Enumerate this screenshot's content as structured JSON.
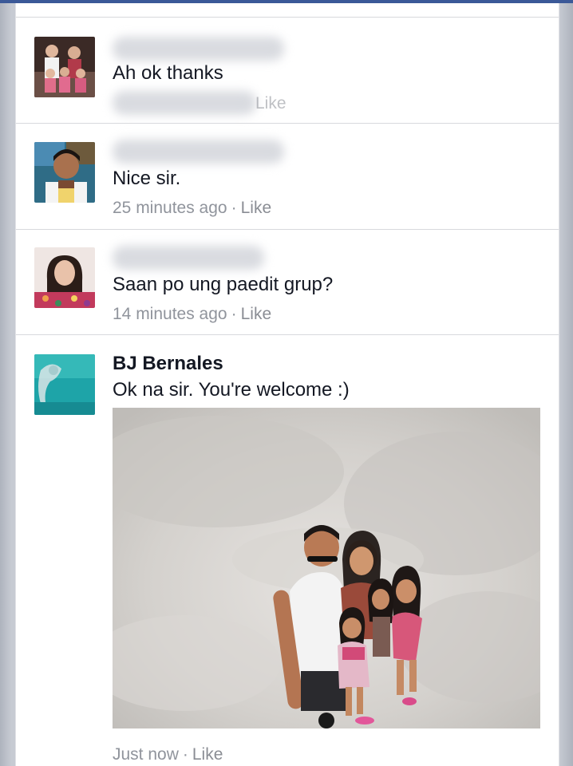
{
  "comments": [
    {
      "text": "Ah ok thanks",
      "like": "Like"
    },
    {
      "text": "Nice sir.",
      "time": "25 minutes ago",
      "like": "Like"
    },
    {
      "text": "Saan po ung paedit grup?",
      "time": "14 minutes ago",
      "like": "Like"
    },
    {
      "name": "BJ Bernales",
      "text": "Ok na sir. You're welcome :)",
      "time": "Just now",
      "like": "Like"
    }
  ],
  "separator": "·",
  "colors": {
    "brand_bar": "#3b5998",
    "name_text": "#141823",
    "meta_text": "#90949c",
    "background": "#ffffff"
  }
}
